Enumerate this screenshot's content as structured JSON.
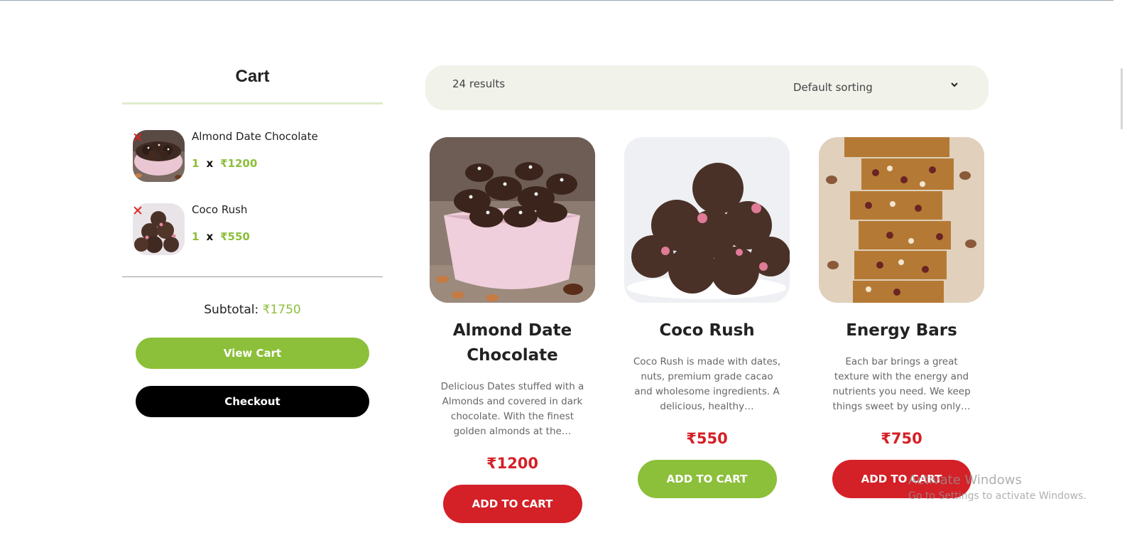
{
  "cart": {
    "title": "Cart",
    "items": [
      {
        "name": "Almond Date Chocolate",
        "qty": "1",
        "times": "x",
        "price": "₹1200",
        "remove_icon": "close-icon"
      },
      {
        "name": "Coco Rush",
        "qty": "1",
        "times": "x",
        "price": "₹550",
        "remove_icon": "close-icon"
      }
    ],
    "subtotal_label": "Subtotal:",
    "subtotal_value": "₹1750",
    "view_cart_label": "View Cart",
    "checkout_label": "Checkout"
  },
  "toolbar": {
    "results": "24 results",
    "sorting": "Default sorting",
    "sorting_icon": "chevron-down-icon"
  },
  "products": [
    {
      "name": "Almond Date Chocolate",
      "description": "Delicious Dates stuffed with a Almonds and covered in dark chocolate. With the finest golden almonds at the…",
      "price": "₹1200",
      "button": "ADD TO CART",
      "button_color": "#d42027"
    },
    {
      "name": "Coco Rush",
      "description": "Coco Rush is made with dates, nuts, premium grade cacao and wholesome ingredients. A delicious, healthy…",
      "price": "₹550",
      "button": "ADD TO CART",
      "button_color": "#8cbf3a"
    },
    {
      "name": "Energy Bars",
      "description": "Each bar brings a great texture with the energy and nutrients you need. We keep things sweet by using only…",
      "price": "₹750",
      "button": "ADD TO CART",
      "button_color": "#d42027"
    }
  ],
  "watermark": {
    "title": "Activate Windows",
    "subtitle": "Go to Settings to activate Windows."
  },
  "colors": {
    "accent_green": "#8cbf3a",
    "accent_red": "#d42027",
    "toolbar_bg": "#f1f2ea"
  }
}
